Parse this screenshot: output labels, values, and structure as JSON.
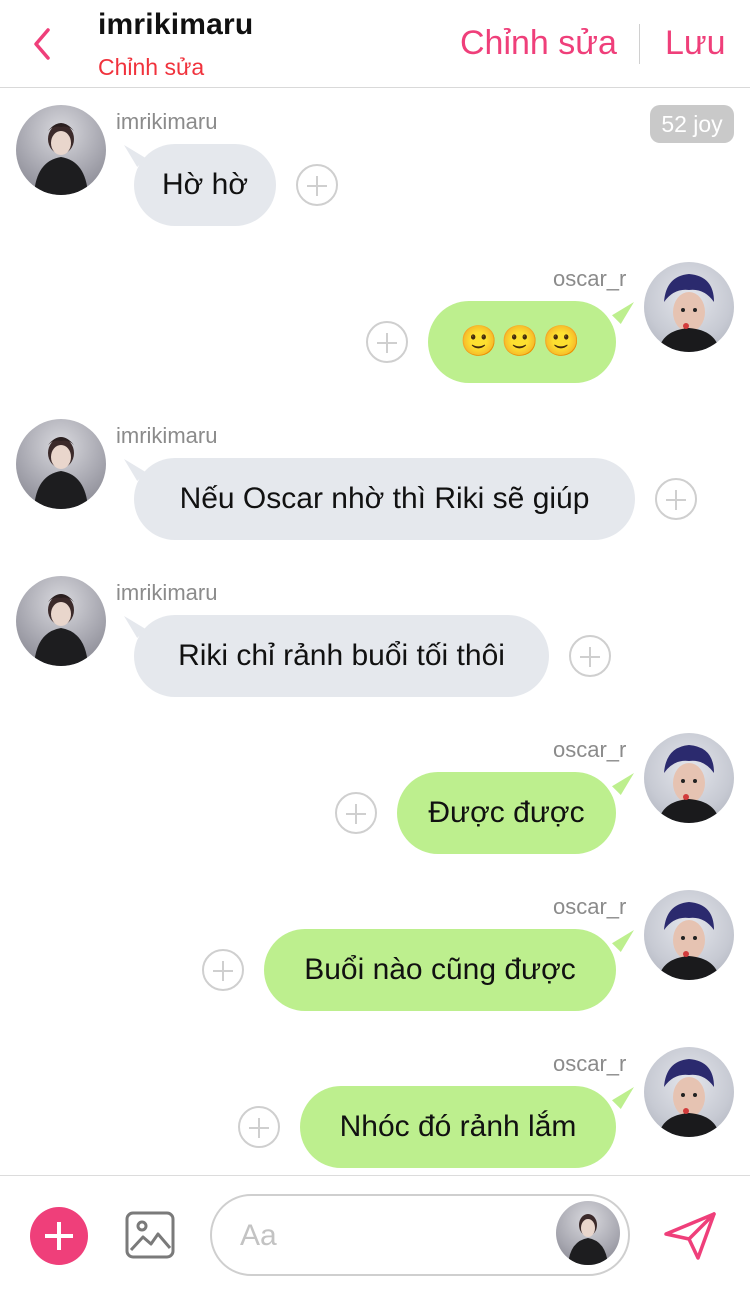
{
  "header": {
    "title": "imrikimaru",
    "subtitle": "Chỉnh sửa",
    "edit_label": "Chỉnh sửa",
    "save_label": "Lưu"
  },
  "badge": "52 joy",
  "messages": [
    {
      "sender": "imrikimaru",
      "side": "in",
      "text": "Hờ hờ"
    },
    {
      "sender": "oscar_r",
      "side": "out",
      "text": "🙂🙂🙂"
    },
    {
      "sender": "imrikimaru",
      "side": "in",
      "text": "Nếu Oscar nhờ thì Riki sẽ giúp"
    },
    {
      "sender": "imrikimaru",
      "side": "in",
      "text": "Riki chỉ rảnh buổi tối thôi"
    },
    {
      "sender": "oscar_r",
      "side": "out",
      "text": "Được được"
    },
    {
      "sender": "oscar_r",
      "side": "out",
      "text": "Buổi nào cũng được"
    },
    {
      "sender": "oscar_r",
      "side": "out",
      "text": "Nhóc đó rảnh lắm"
    }
  ],
  "composer": {
    "placeholder": "Aa",
    "icons": [
      "plus-icon",
      "image-icon",
      "send-icon"
    ]
  },
  "colors": {
    "accent": "#ef3f7a",
    "subtitle_red": "#f0323c",
    "incoming_bubble": "#e5e8ed",
    "outgoing_bubble": "#bdef8e"
  }
}
